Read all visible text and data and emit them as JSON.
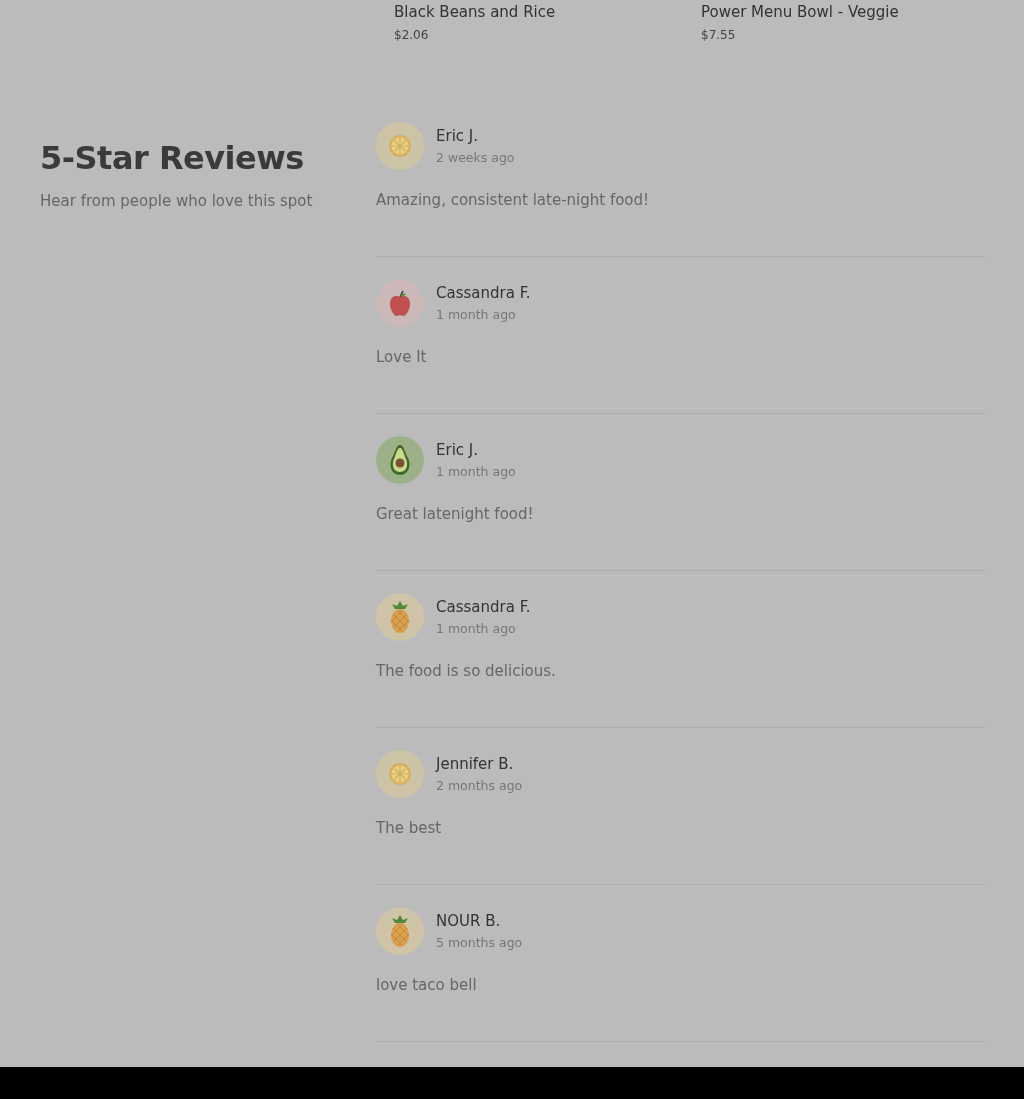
{
  "menu_items": [
    {
      "name": "Black Beans and Rice",
      "price": "$2.06"
    },
    {
      "name": "Power Menu Bowl - Veggie",
      "price": "$7.55"
    }
  ],
  "reviews_section": {
    "title": "5-Star Reviews",
    "subtitle": "Hear from people who love this spot",
    "reviews": [
      {
        "author": "Eric J.",
        "time": "2 weeks ago",
        "text": "Amazing, consistent late-night food!",
        "kind": "citrus"
      },
      {
        "author": "Cassandra F.",
        "time": "1 month ago",
        "text": "Love It",
        "kind": "apple"
      },
      {
        "author": "Eric J.",
        "time": "1 month ago",
        "text": "Great latenight food!",
        "kind": "avocado"
      },
      {
        "author": "Cassandra F.",
        "time": "1 month ago",
        "text": "The food is so delicious.",
        "kind": "pineapple"
      },
      {
        "author": "Jennifer B.",
        "time": "2 months ago",
        "text": "The best",
        "kind": "citrus"
      },
      {
        "author": "NOUR B.",
        "time": "5 months ago",
        "text": "love taco bell",
        "kind": "pineapple"
      }
    ]
  }
}
